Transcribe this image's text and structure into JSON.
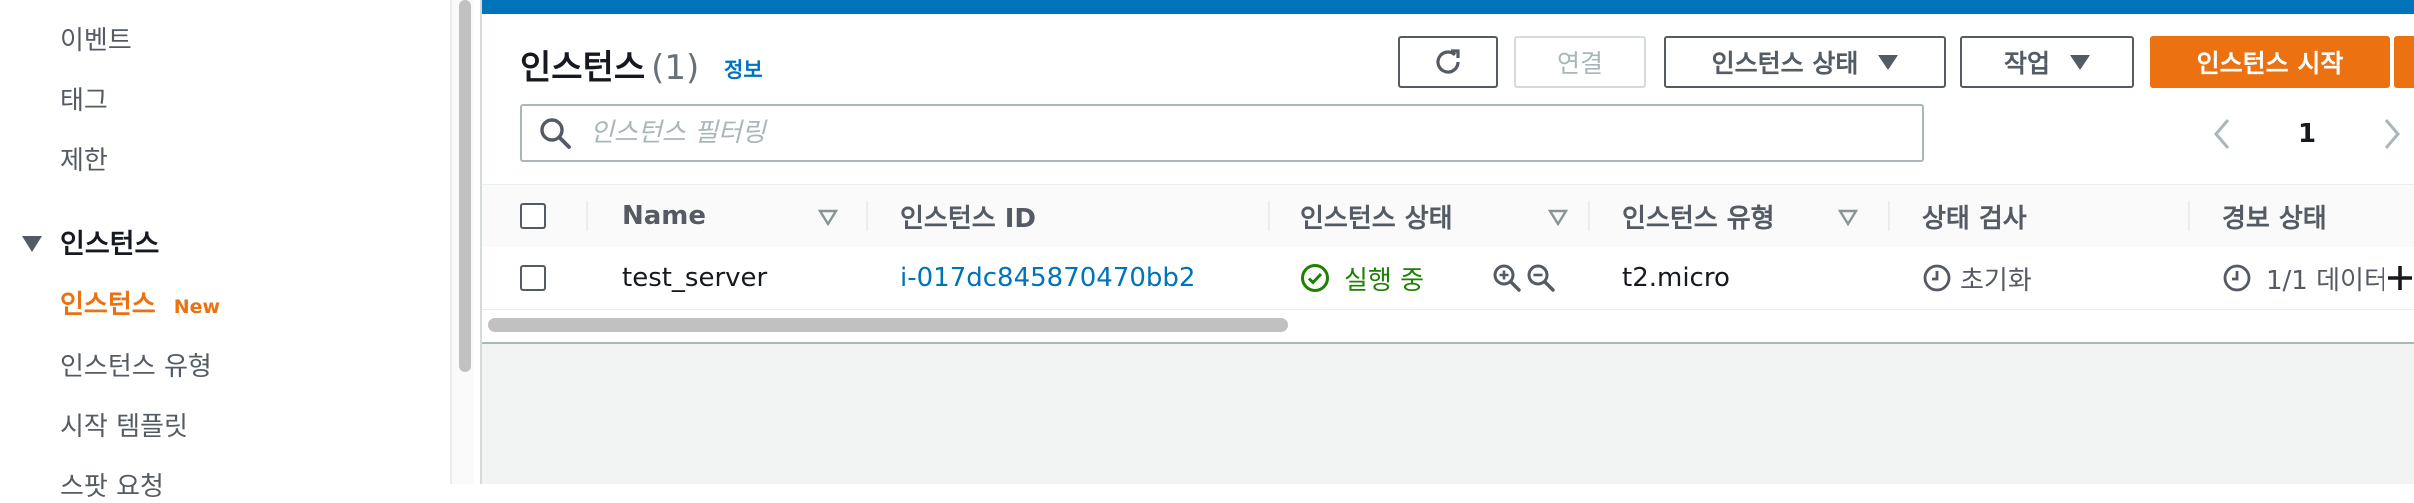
{
  "sidebar": {
    "items": [
      {
        "label": "이벤트"
      },
      {
        "label": "태그"
      },
      {
        "label": "제한"
      }
    ],
    "section": {
      "label": "인스턴스"
    },
    "sub_items": [
      {
        "label": "인스턴스",
        "badge": "New",
        "active": true
      },
      {
        "label": "인스턴스 유형"
      },
      {
        "label": "시작 템플릿"
      },
      {
        "label": "스팟 요청"
      }
    ]
  },
  "header": {
    "title": "인스턴스",
    "count": "(1)",
    "info_label": "정보"
  },
  "toolbar": {
    "refresh_icon": "refresh-icon",
    "connect_label": "연결",
    "instance_state_label": "인스턴스 상태",
    "actions_label": "작업",
    "launch_label": "인스턴스 시작"
  },
  "search": {
    "placeholder": "인스턴스 필터링",
    "value": ""
  },
  "pagination": {
    "current_page": "1"
  },
  "table": {
    "columns": [
      "Name",
      "인스턴스 ID",
      "인스턴스 상태",
      "인스턴스 유형",
      "상태 검사",
      "경보 상태"
    ],
    "rows": [
      {
        "name": "test_server",
        "instance_id": "i-017dc845870470bb2",
        "state": "실행 중",
        "type": "t2.micro",
        "status_check": "초기화",
        "alarm": "1/1 데이터"
      }
    ]
  },
  "colors": {
    "accent": "#ec7211",
    "link": "#0073bb",
    "success": "#1d8102",
    "topbar": "#0073bb"
  }
}
